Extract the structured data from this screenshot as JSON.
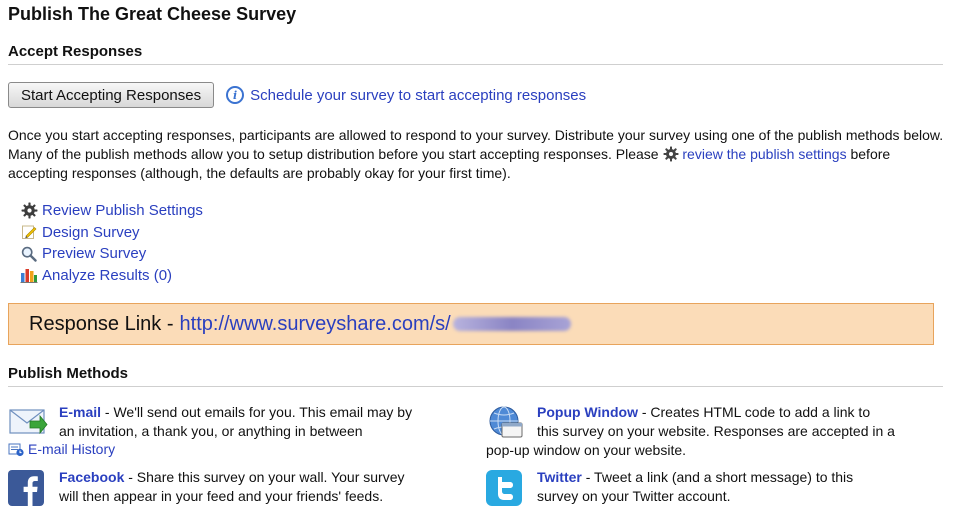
{
  "page": {
    "title": "Publish The Great Cheese Survey"
  },
  "accept": {
    "heading": "Accept Responses",
    "start_button": "Start Accepting Responses",
    "schedule_link": "Schedule your survey to start accepting responses",
    "intro_before": "Once you start accepting responses, participants are allowed to respond to your survey. Distribute your survey using one of the publish methods below. Many of the publish methods allow you to setup distribution before you start accepting responses. Please",
    "intro_link": "review the publish settings",
    "intro_after": "before accepting responses (although, the defaults are probably okay for your first time)."
  },
  "quick_links": [
    {
      "label": "Review Publish Settings",
      "icon": "gear-icon"
    },
    {
      "label": "Design Survey",
      "icon": "pencil-icon"
    },
    {
      "label": "Preview Survey",
      "icon": "magnifier-icon"
    },
    {
      "label": "Analyze Results (0)",
      "icon": "bar-chart-icon"
    }
  ],
  "response_link": {
    "label": "Response Link -",
    "url": "http://www.surveyshare.com/s/"
  },
  "methods": {
    "heading": "Publish Methods",
    "email": {
      "title": "E-mail",
      "line1": " - We'll send out emails for you. This email may by",
      "line2": "an invitation, a thank you, or anything in between",
      "history_link": "E-mail History"
    },
    "popup": {
      "title": "Popup Window",
      "line1": " - Creates HTML code to add a link to",
      "line2": "this survey on your website. Responses are accepted in a",
      "line3": "pop-up window on your website."
    },
    "facebook": {
      "title": "Facebook",
      "line1": " - Share this survey on your wall. Your survey",
      "line2": "will then appear in your feed and your friends' feeds."
    },
    "twitter": {
      "title": "Twitter",
      "line1": " - Tweet a link (and a short message) to this",
      "line2": "survey on your Twitter account."
    }
  },
  "colors": {
    "link": "#2a3fbf",
    "response_box_bg": "#fbdcb8",
    "response_box_border": "#e8a45c",
    "facebook": "#3b5998",
    "twitter": "#29a9e1"
  }
}
